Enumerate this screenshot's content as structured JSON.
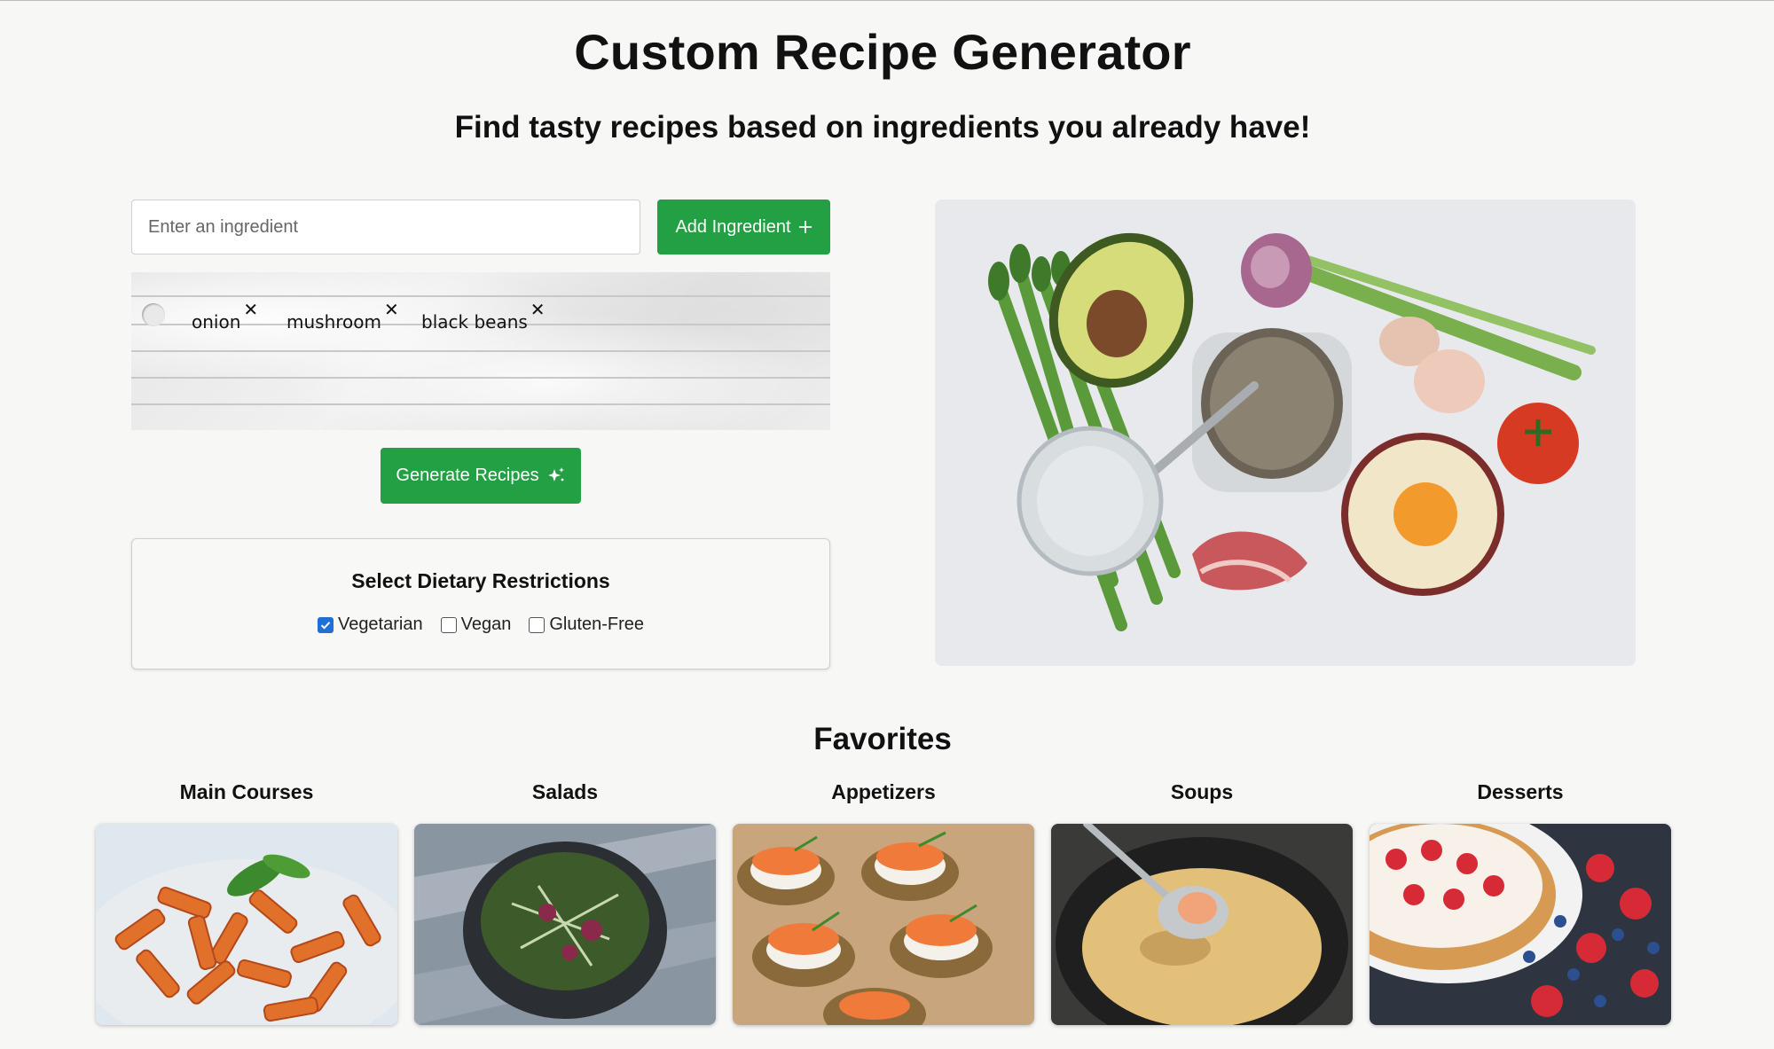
{
  "header": {
    "title": "Custom Recipe Generator",
    "subtitle": "Find tasty recipes based on ingredients you already have!"
  },
  "ingredient_form": {
    "input_placeholder": "Enter an ingredient",
    "input_value": "",
    "add_button_label": "Add Ingredient",
    "add_button_icon": "plus-icon"
  },
  "ingredient_list": {
    "items": [
      {
        "label": "onion"
      },
      {
        "label": "mushroom"
      },
      {
        "label": "black beans"
      }
    ],
    "remove_icon": "close-icon"
  },
  "generate": {
    "label": "Generate Recipes",
    "icon": "sparkles-icon"
  },
  "dietary": {
    "title": "Select Dietary Restrictions",
    "options": [
      {
        "label": "Vegetarian",
        "checked": true
      },
      {
        "label": "Vegan",
        "checked": false
      },
      {
        "label": "Gluten-Free",
        "checked": false
      }
    ]
  },
  "favorites": {
    "title": "Favorites",
    "categories": [
      {
        "label": "Main Courses"
      },
      {
        "label": "Salads"
      },
      {
        "label": "Appetizers"
      },
      {
        "label": "Soups"
      },
      {
        "label": "Desserts"
      }
    ]
  },
  "colors": {
    "accent_green": "#22a043",
    "checkbox_blue": "#1f6fd6",
    "page_background": "#f7f7f6"
  }
}
